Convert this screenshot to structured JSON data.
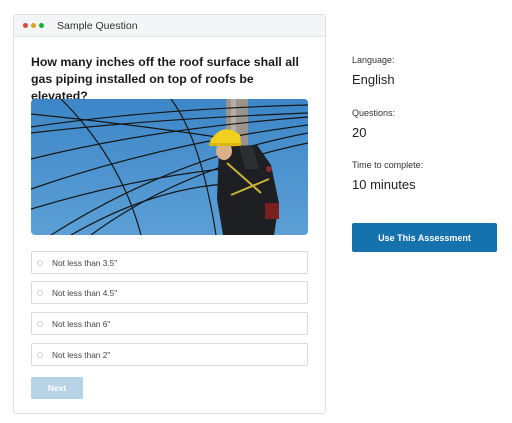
{
  "window": {
    "title": "Sample Question",
    "dot_colors": [
      "#e0443e",
      "#dea123",
      "#1aab29"
    ]
  },
  "question": {
    "text": "How many inches off the roof surface shall all gas piping installed on top of roofs be elevated?"
  },
  "options": [
    {
      "label": "Not less than 3.5\""
    },
    {
      "label": "Not less than 4.5\""
    },
    {
      "label": "Not less than 6\""
    },
    {
      "label": "Not less than 2\""
    }
  ],
  "next_label": "Next",
  "details": {
    "language_label": "Language:",
    "language_value": "English",
    "questions_label": "Questions:",
    "questions_value": "20",
    "time_label": "Time to complete:",
    "time_value": "10 minutes"
  },
  "cta_label": "Use This Assessment",
  "colors": {
    "primary": "#1572ad",
    "next_disabled": "#b7d3e8"
  }
}
